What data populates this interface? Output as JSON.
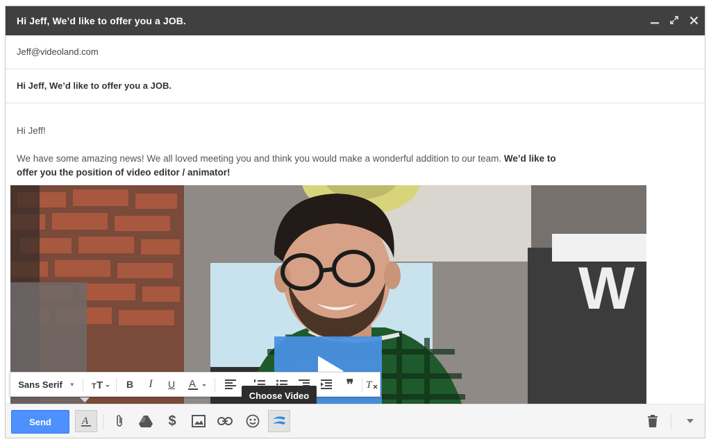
{
  "window": {
    "title": "Hi Jeff, We’d like to offer you a JOB.",
    "controls": [
      "minimize-icon",
      "expand-icon",
      "close-icon"
    ]
  },
  "to": "Jeff@videoland.com",
  "subject": "Hi Jeff, We’d like to offer you a JOB.",
  "body": {
    "greeting": "Hi Jeff!",
    "paragraph_plain": "We have some amazing news! We all loved meeting you and think you would make a wonderful addition to our team.",
    "paragraph_bold": "We’d like to offer you the position of video editor / animator!"
  },
  "video": {
    "play_button_color": "#4a90e2",
    "sign_letter": "W"
  },
  "format_toolbar": {
    "font": "Sans Serif",
    "tools": [
      "text-size-icon",
      "bold-icon",
      "italic-icon",
      "underline-icon",
      "text-color-icon",
      "align-icon",
      "numbered-list-icon",
      "bulleted-list-icon",
      "indent-less-icon",
      "indent-more-icon",
      "quote-icon",
      "remove-formatting-icon"
    ]
  },
  "tooltip": "Choose Video",
  "bottom_toolbar": {
    "send_label": "Send",
    "send_color": "#4d90fe",
    "tools": [
      "formatting-icon",
      "attach-icon",
      "drive-icon",
      "money-icon",
      "photo-icon",
      "link-icon",
      "emoji-icon",
      "video-icon",
      "trash-icon",
      "more-options-icon"
    ]
  }
}
